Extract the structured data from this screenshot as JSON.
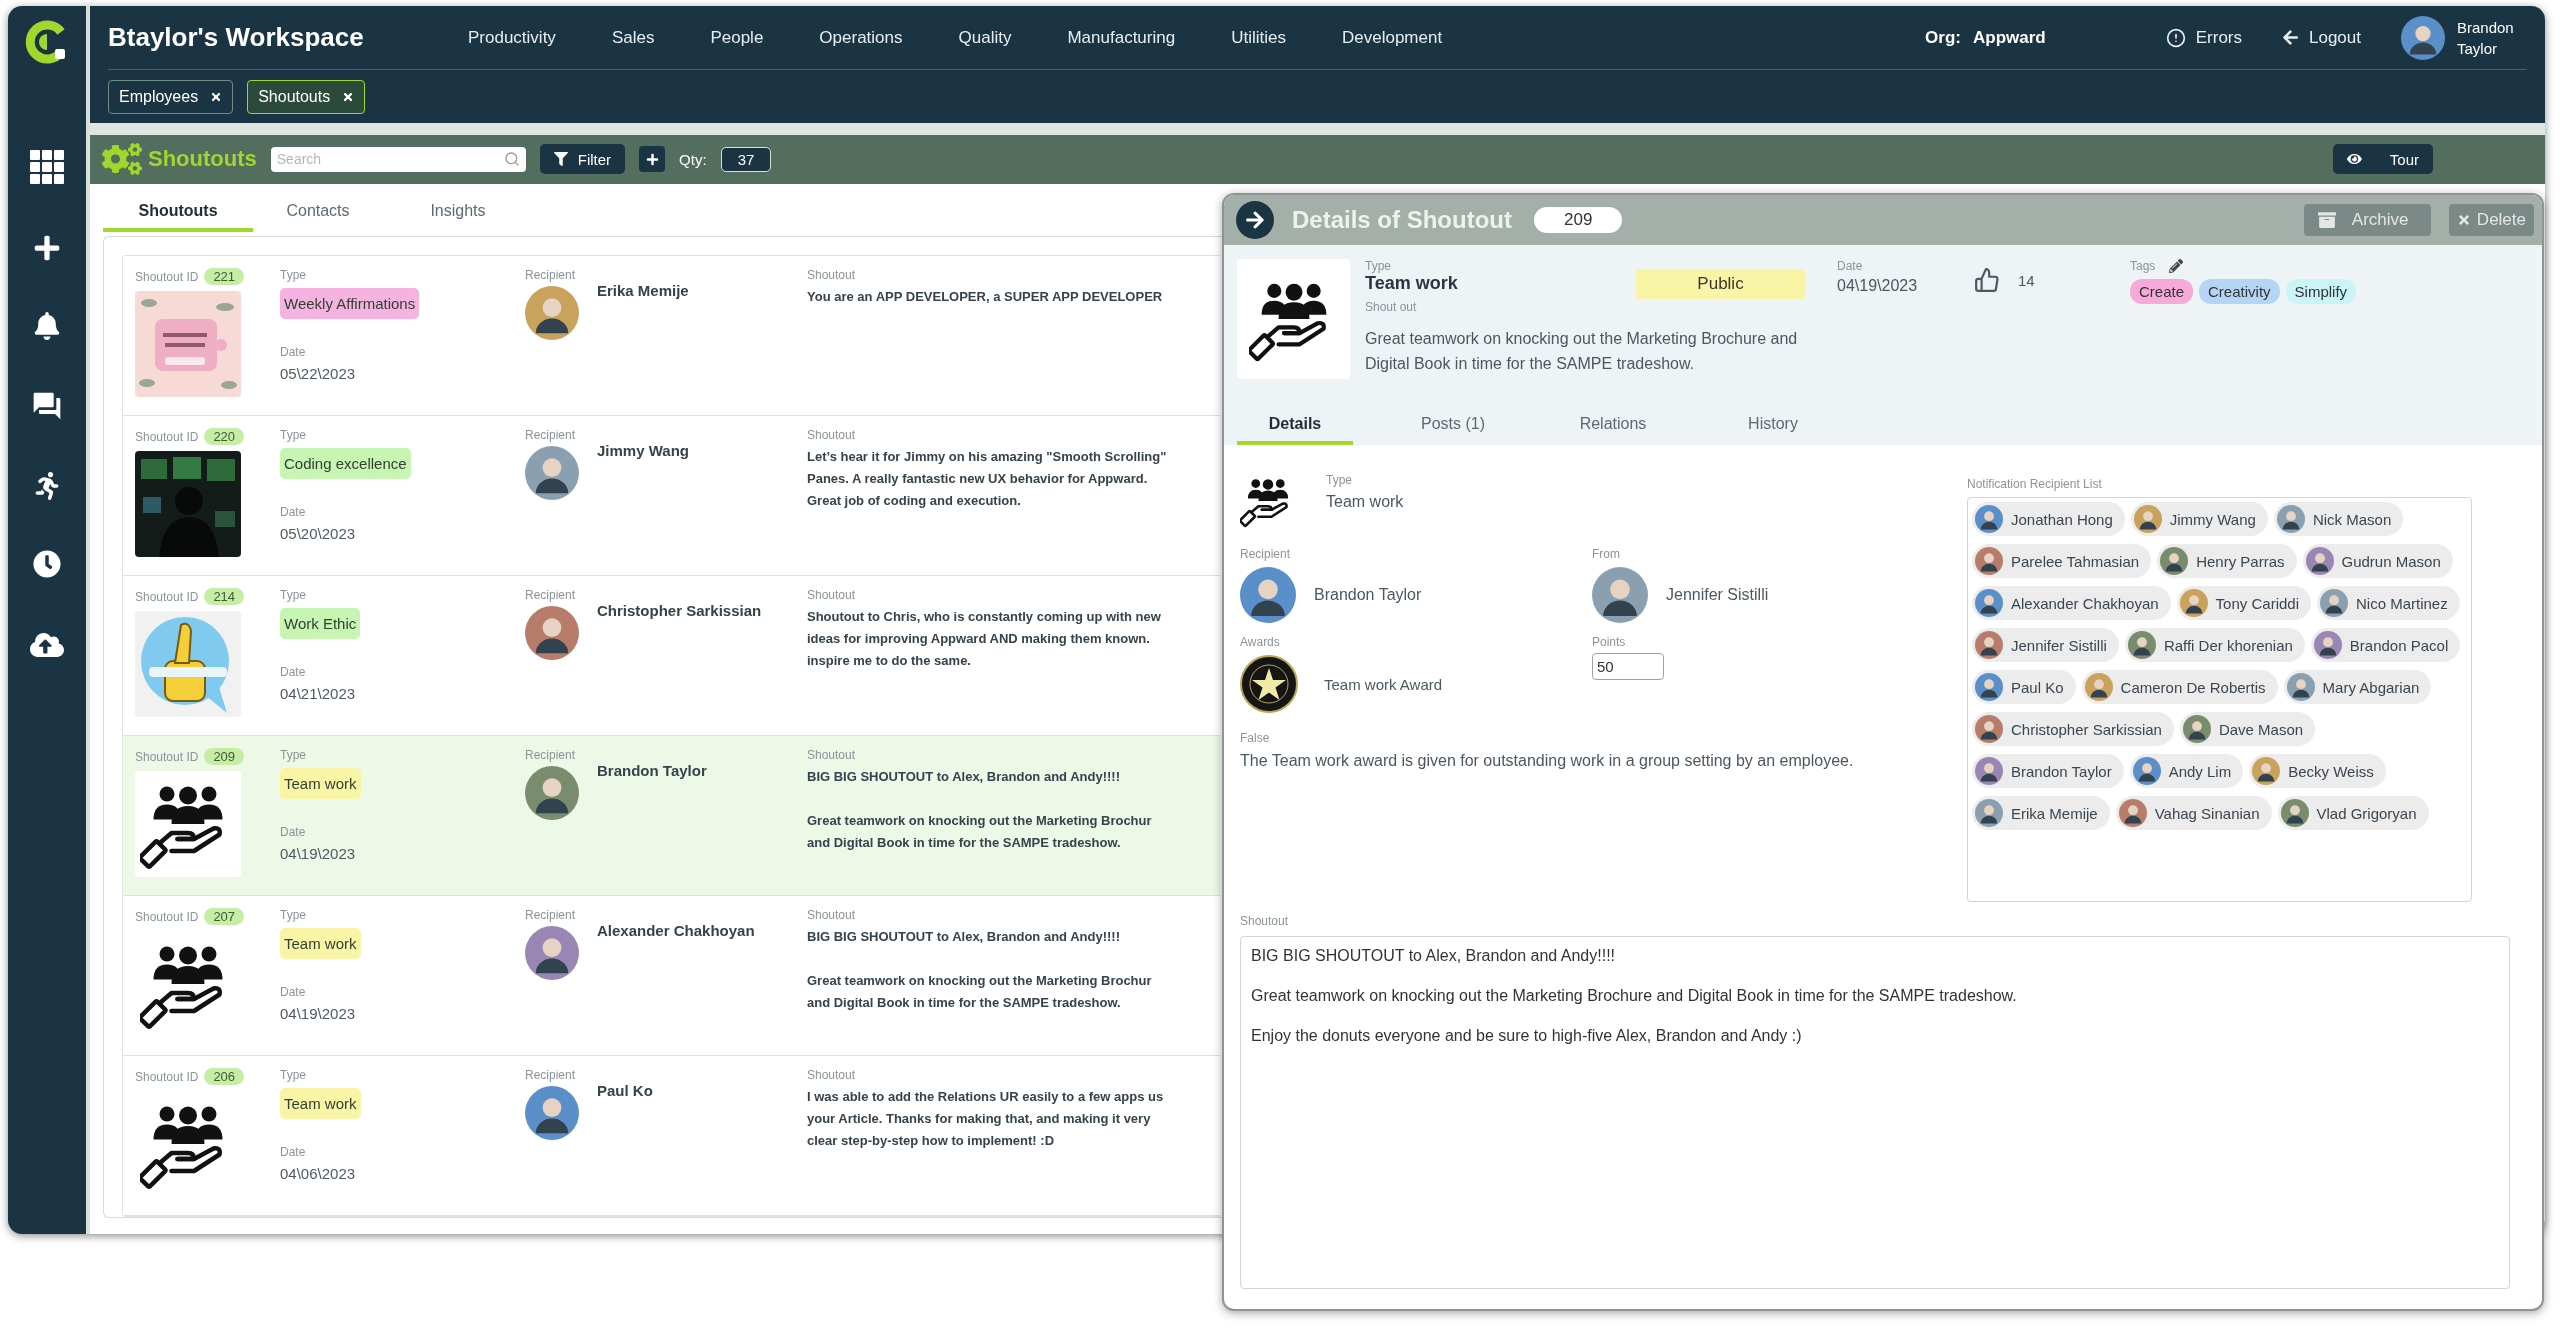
{
  "header": {
    "title": "Btaylor's Workspace",
    "nav": [
      "Productivity",
      "Sales",
      "People",
      "Operations",
      "Quality",
      "Manufacturing",
      "Utilities",
      "Development"
    ],
    "org_label": "Org:",
    "org": "Appward",
    "errors": "Errors",
    "logout": "Logout",
    "user": "Brandon Taylor"
  },
  "open_tabs": [
    {
      "label": "Employees",
      "selected": false
    },
    {
      "label": "Shoutouts",
      "selected": true
    }
  ],
  "toolbar": {
    "title": "Shoutouts",
    "search_placeholder": "Search",
    "filter": "Filter",
    "qty_label": "Qty:",
    "qty": "37",
    "tour": "Tour"
  },
  "list_tabs": [
    {
      "label": "Shoutouts",
      "selected": true
    },
    {
      "label": "Contacts",
      "selected": false
    },
    {
      "label": "Insights",
      "selected": false
    }
  ],
  "rows": [
    {
      "id_label": "Shoutout ID",
      "id": "221",
      "type_label": "Type",
      "type": "Weekly Affirmations",
      "color": "#f4b3e1",
      "date_label": "Date",
      "date": "05\\22\\2023",
      "recipient_label": "Recipient",
      "recipient": "Erika Memije",
      "shoutout_label": "Shoutout",
      "shoutout": [
        [
          "You are an APP DEVELOPER, a SUPER APP DEVELOPER"
        ]
      ],
      "kind": "picture",
      "selected": false
    },
    {
      "id_label": "Shoutout ID",
      "id": "220",
      "type_label": "Type",
      "type": "Coding excellence",
      "color": "#c6f5b4",
      "date_label": "Date",
      "date": "05\\20\\2023",
      "recipient_label": "Recipient",
      "recipient": "Jimmy Wang",
      "shoutout_label": "Shoutout",
      "shoutout": [
        [
          "Let’s hear it for Jimmy on his amazing \"Smooth Scrolling\"",
          "Panes.  A really fantastic new UX behavior for Appward.",
          "Great job of coding and execution."
        ]
      ],
      "kind": "picture",
      "selected": false
    },
    {
      "id_label": "Shoutout ID",
      "id": "214",
      "type_label": "Type",
      "type": "Work Ethic",
      "color": "#c6f5b4",
      "date_label": "Date",
      "date": "04\\21\\2023",
      "recipient_label": "Recipient",
      "recipient": "Christopher Sarkissian",
      "shoutout_label": "Shoutout",
      "shoutout": [
        [
          "Shoutout to Chris, who is constantly coming up with new",
          "ideas for improving Appward AND making them known.",
          "inspire me to do the same."
        ]
      ],
      "kind": "picture",
      "selected": false
    },
    {
      "id_label": "Shoutout ID",
      "id": "209",
      "type_label": "Type",
      "type": "Team work",
      "color": "#f8f5a6",
      "date_label": "Date",
      "date": "04\\19\\2023",
      "recipient_label": "Recipient",
      "recipient": "Brandon Taylor",
      "shoutout_label": "Shoutout",
      "shoutout": [
        [
          "BIG BIG SHOUTOUT to Alex, Brandon and Andy!!!!"
        ],
        [
          "Great teamwork on knocking out the Marketing Brochur",
          "and Digital Book in time for the SAMPE tradeshow."
        ]
      ],
      "kind": "team",
      "selected": true
    },
    {
      "id_label": "Shoutout ID",
      "id": "207",
      "type_label": "Type",
      "type": "Team work",
      "color": "#f8f5a6",
      "date_label": "Date",
      "date": "04\\19\\2023",
      "recipient_label": "Recipient",
      "recipient": "Alexander Chakhoyan",
      "shoutout_label": "Shoutout",
      "shoutout": [
        [
          "BIG BIG SHOUTOUT to Alex, Brandon and Andy!!!!"
        ],
        [
          "Great teamwork on knocking out the Marketing Brochur",
          "and Digital Book in time for the SAMPE tradeshow."
        ]
      ],
      "kind": "team",
      "selected": false
    },
    {
      "id_label": "Shoutout ID",
      "id": "206",
      "type_label": "Type",
      "type": "Team work",
      "color": "#f8f5a6",
      "date_label": "Date",
      "date": "04\\06\\2023",
      "recipient_label": "Recipient",
      "recipient": "Paul Ko",
      "shoutout_label": "Shoutout",
      "shoutout": [
        [
          "I was able to add the Relations UR easily to a few apps us",
          "your Article. Thanks for making that, and making it very",
          "clear step-by-step how to implement! :D"
        ]
      ],
      "kind": "team",
      "selected": false
    }
  ],
  "detail": {
    "title": "Details of Shoutout",
    "id": "209",
    "archive": "Archive",
    "delete": "Delete",
    "type_label": "Type",
    "type": "Team work",
    "subtitle": "Shout out",
    "summary": "Great teamwork on knocking out the Marketing Brochure and Digital Book in time for the SAMPE tradeshow.",
    "visibility": "Public",
    "date_label": "Date",
    "date": "04\\19\\2023",
    "likes": "14",
    "tags_label": "Tags",
    "tags": [
      {
        "label": "Create",
        "color": "#f7a9d9"
      },
      {
        "label": "Creativity",
        "color": "#b5d5f7"
      },
      {
        "label": "Simplify",
        "color": "#cbf4f6"
      }
    ],
    "tabs": [
      {
        "label": "Details",
        "selected": true
      },
      {
        "label": "Posts (1)",
        "selected": false
      },
      {
        "label": "Relations",
        "selected": false
      },
      {
        "label": "History",
        "selected": false
      }
    ],
    "fields": {
      "type_label": "Type",
      "type": "Team work",
      "recipient_label": "Recipient",
      "recipient": "Brandon Taylor",
      "from_label": "From",
      "from": "Jennifer Sistilli",
      "awards_label": "Awards",
      "award": "Team work Award",
      "points_label": "Points",
      "points": "50",
      "note_label": "False",
      "note": "The Team work award is given for outstanding work in a group setting by an employee.",
      "recipients_label": "Notification Recipient List",
      "recipients": [
        "Jonathan Hong",
        "Jimmy Wang",
        "Nick Mason",
        "Parelee Tahmasian",
        "Henry Parras",
        "Gudrun Mason",
        "Alexander Chakhoyan",
        "Tony Cariddi",
        "Nico Martinez",
        "Jennifer Sistilli",
        "Raffi Der khorenian",
        "Brandon Pacol",
        "Paul Ko",
        "Cameron De Robertis",
        "Mary Abgarian",
        "Christopher Sarkissian",
        "Dave Mason",
        "Brandon Taylor",
        "Andy Lim",
        "Becky Weiss",
        "Erika Memije",
        "Vahag Sinanian",
        "Vlad Grigoryan"
      ],
      "shoutout_label": "Shoutout",
      "shoutout": [
        "BIG BIG SHOUTOUT to Alex, Brandon and Andy!!!!",
        "Great teamwork on knocking out the Marketing Brochure and Digital Book in time for the SAMPE tradeshow.",
        "Enjoy the donuts everyone and be sure to high-five Alex, Brandon and Andy :)"
      ]
    }
  }
}
